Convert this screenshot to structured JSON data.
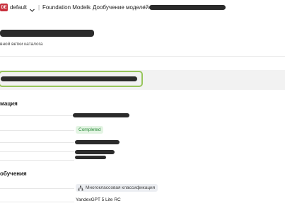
{
  "breadcrumb": {
    "badge": "DE",
    "folder": "default",
    "section": "Foundation Models",
    "page": "Дообучение моделей"
  },
  "header": {
    "subtitle": "вной ветки каталога"
  },
  "info_section": {
    "title": "мация",
    "status": "Completed"
  },
  "training_section": {
    "title": "обучения",
    "task_type": "Многоклассовая классификация",
    "base_model": "YandexGPT 5 Lite RC"
  },
  "colors": {
    "accent_border": "#97c55b",
    "status_bg": "#e3f4e3",
    "status_text": "#2a8a3a",
    "badge_bg": "#c8313d"
  },
  "icons": {
    "folder_chevron": "chevron-down-icon",
    "task_type": "network-icon"
  }
}
